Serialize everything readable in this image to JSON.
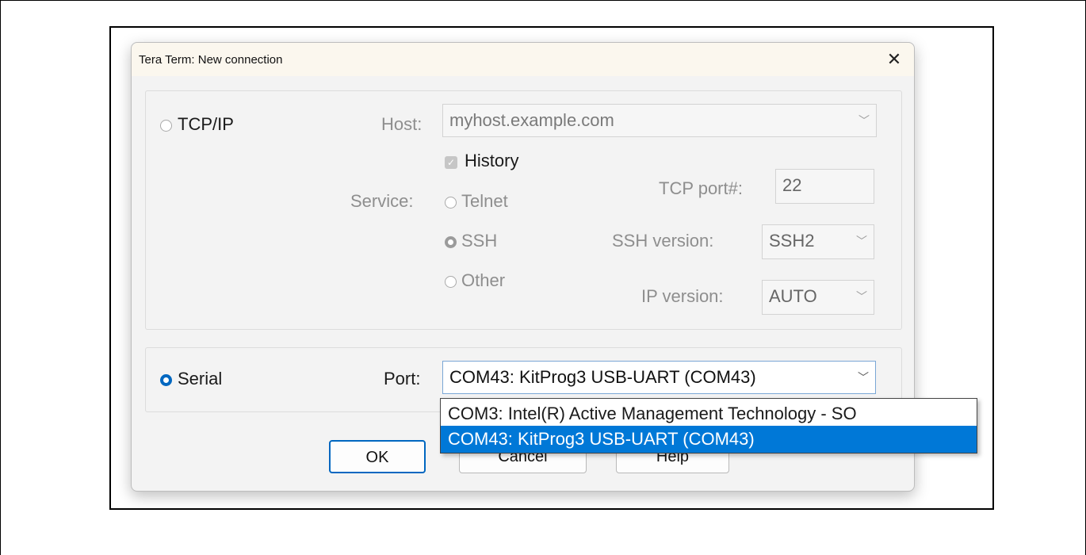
{
  "dialog": {
    "title": "Tera Term: New connection",
    "close_glyph": "✕"
  },
  "tcpip": {
    "radio_label": "TCP/IP",
    "selected": false,
    "host_label": "Host:",
    "host_value": "myhost.example.com",
    "history_label": "History",
    "history_checked": true,
    "service_label": "Service:",
    "services": [
      {
        "label": "Telnet",
        "selected": false
      },
      {
        "label": "SSH",
        "selected": true
      },
      {
        "label": "Other",
        "selected": false
      }
    ],
    "tcp_port_label": "TCP port#:",
    "tcp_port_value": "22",
    "ssh_version_label": "SSH version:",
    "ssh_version_value": "SSH2",
    "ip_version_label": "IP version:",
    "ip_version_value": "AUTO"
  },
  "serial": {
    "radio_label": "Serial",
    "selected": true,
    "port_label": "Port:",
    "port_value": "COM43: KitProg3 USB-UART (COM43)",
    "dropdown_options": [
      {
        "label": "COM3: Intel(R) Active Management Technology - SO",
        "selected": false
      },
      {
        "label": "COM43: KitProg3 USB-UART (COM43)",
        "selected": true
      }
    ]
  },
  "buttons": {
    "ok": "OK",
    "cancel": "Cancel",
    "help": "Help"
  },
  "icons": {
    "chevron": "﹀",
    "checkmark": "✓"
  },
  "colors": {
    "accent": "#0067c0",
    "selection": "#0078d7",
    "titlebar": "#fbf7ee",
    "dialog_bg": "#f3f3f3"
  }
}
